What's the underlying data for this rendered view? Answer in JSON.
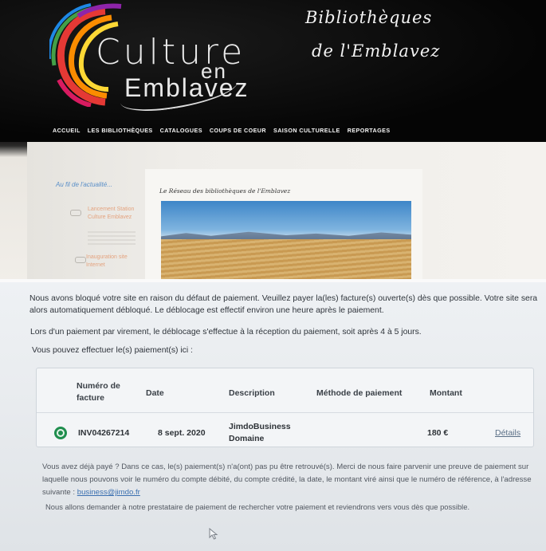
{
  "site": {
    "logo": {
      "word1": "Culture",
      "word2": "en",
      "word3": "Emblavez"
    },
    "brand": {
      "line1": "Bibliothèques",
      "line2": "de l'Emblavez"
    },
    "nav": [
      "ACCUEIL",
      "LES BIBLIOTHÈQUES",
      "CATALOGUES",
      "COUPS DE COEUR",
      "SAISON CULTURELLE",
      "REPORTAGES"
    ],
    "sidebar": {
      "title": "Au fil de l'actualité...",
      "items": [
        "Lancement Station Culture Emblavez",
        "Inauguration site Internet"
      ]
    },
    "content_title": "Le Réseau des bibliothèques de l'Emblavez"
  },
  "notice": {
    "p1": "Nous avons bloqué votre site en raison du défaut de paiement. Veuillez payer la(les) facture(s) ouverte(s) dès que possible. Votre site sera alors automatiquement débloqué. Le déblocage est effectif environ une heure après le paiement.",
    "p2": "Lors d'un paiement par virement, le déblocage s'effectue à la réception du paiement, soit après 4 à 5 jours.",
    "p3": "Vous pouvez effectuer le(s) paiement(s) ici :",
    "table": {
      "headers": {
        "number": "Numéro de facture",
        "date": "Date",
        "description": "Description",
        "method": "Méthode de paiement",
        "amount": "Montant"
      },
      "row": {
        "invoice": "INV04267214",
        "date": "8 sept. 2020",
        "description": "JimdoBusiness Domaine",
        "method": "",
        "amount": "180 €",
        "details": "Détails"
      }
    },
    "p4_text": "Vous avez déjà payé ? Dans ce cas, le(s) paiement(s) n'a(ont) pas pu être retrouvé(s). Merci de nous faire parvenir une preuve de paiement sur laquelle nous pouvons voir le numéro du compte débité, du compte crédité, la date, le montant viré ainsi que le numéro de référence, à l'adresse suivante :",
    "p4_email": "business@jimdo.fr",
    "p5": "Nous allons demander à notre prestataire de paiement de rechercher votre paiement et reviendrons vers vous dès que possible."
  }
}
